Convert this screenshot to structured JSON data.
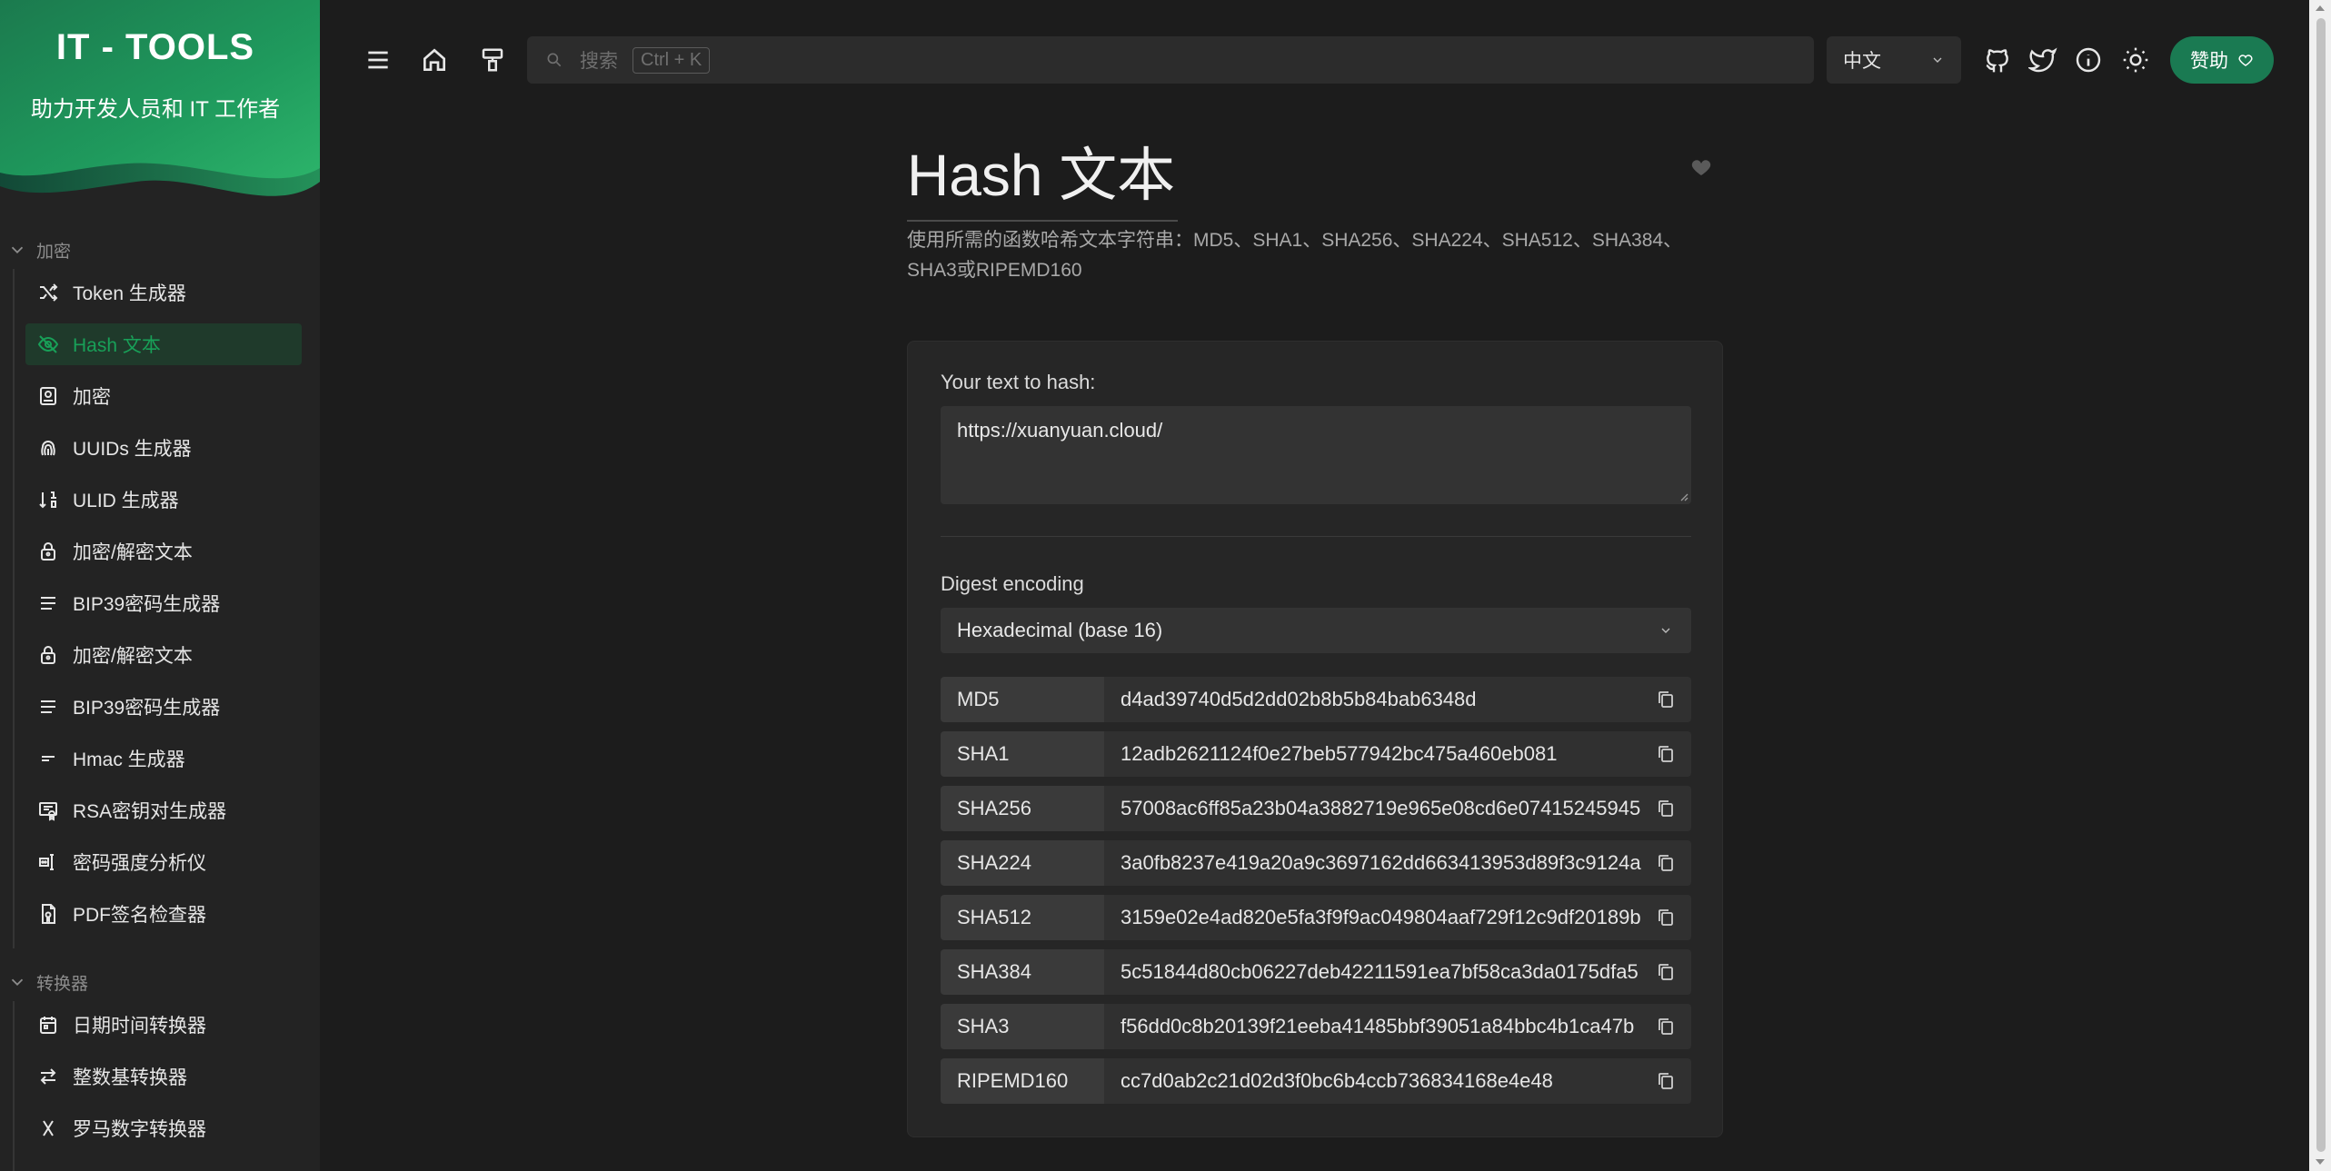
{
  "brand": {
    "title": "IT - TOOLS",
    "subtitle": "助力开发人员和 IT 工作者"
  },
  "sidebar": {
    "sections": [
      {
        "label": "加密",
        "items": [
          {
            "label": "Token 生成器",
            "icon": "shuffle-icon"
          },
          {
            "label": "Hash 文本",
            "icon": "eye-off-icon",
            "active": true
          },
          {
            "label": "加密",
            "icon": "key-box-icon"
          },
          {
            "label": "UUIDs 生成器",
            "icon": "fingerprint-icon"
          },
          {
            "label": "ULID 生成器",
            "icon": "sort-numeric-icon"
          },
          {
            "label": "加密/解密文本",
            "icon": "lock-icon"
          },
          {
            "label": "BIP39密码生成器",
            "icon": "lines-icon"
          },
          {
            "label": "加密/解密文本",
            "icon": "lock-icon"
          },
          {
            "label": "BIP39密码生成器",
            "icon": "lines-icon"
          },
          {
            "label": "Hmac 生成器",
            "icon": "short-text-icon"
          },
          {
            "label": "RSA密钥对生成器",
            "icon": "certificate-icon"
          },
          {
            "label": "密码强度分析仪",
            "icon": "password-icon"
          },
          {
            "label": "PDF签名检查器",
            "icon": "file-cert-icon"
          }
        ]
      },
      {
        "label": "转换器",
        "items": [
          {
            "label": "日期时间转换器",
            "icon": "calendar-icon"
          },
          {
            "label": "整数基转换器",
            "icon": "arrows-swap-icon"
          },
          {
            "label": "罗马数字转换器",
            "icon": "letter-x-icon"
          }
        ]
      }
    ]
  },
  "topbar": {
    "search_placeholder": "搜索",
    "search_shortcut": "Ctrl + K",
    "language": "中文",
    "sponsor_label": "赞助"
  },
  "tool": {
    "title": "Hash 文本",
    "description": "使用所需的函数哈希文本字符串：MD5、SHA1、SHA256、SHA224、SHA512、SHA384、SHA3或RIPEMD160",
    "input_label": "Your text to hash:",
    "input_value": "https://xuanyuan.cloud/",
    "encoding_label": "Digest encoding",
    "encoding_value": "Hexadecimal (base 16)",
    "hashes": [
      {
        "name": "MD5",
        "value": "d4ad39740d5d2dd02b8b5b84bab6348d"
      },
      {
        "name": "SHA1",
        "value": "12adb2621124f0e27beb577942bc475a460eb081"
      },
      {
        "name": "SHA256",
        "value": "57008ac6ff85a23b04a3882719e965e08cd6e07415245945"
      },
      {
        "name": "SHA224",
        "value": "3a0fb8237e419a20a9c3697162dd663413953d89f3c9124a"
      },
      {
        "name": "SHA512",
        "value": "3159e02e4ad820e5fa3f9f9ac049804aaf729f12c9df20189b"
      },
      {
        "name": "SHA384",
        "value": "5c51844d80cb06227deb42211591ea7bf58ca3da0175dfa5"
      },
      {
        "name": "SHA3",
        "value": "f56dd0c8b20139f21eeba41485bbf39051a84bbc4b1ca47b"
      },
      {
        "name": "RIPEMD160",
        "value": "cc7d0ab2c21d02d3f0bc6b4ccb736834168e4e48"
      }
    ]
  },
  "colors": {
    "accent": "#18a058",
    "background": "#1c1c1c",
    "sidebar": "#232323",
    "card": "#262626"
  }
}
